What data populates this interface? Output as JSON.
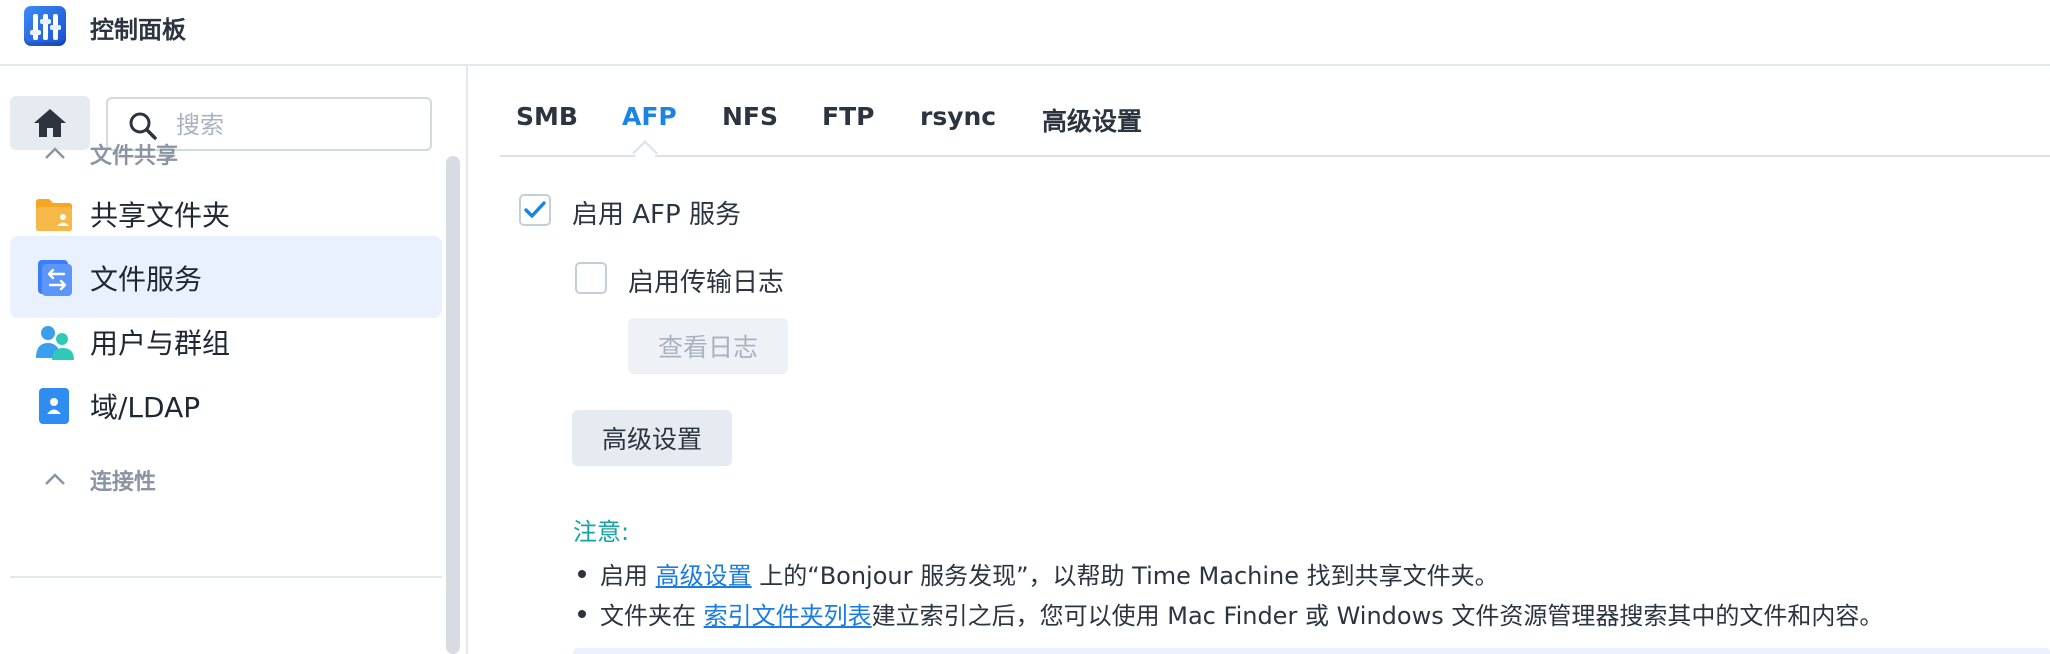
{
  "app": {
    "title": "控制面板",
    "icon": "control-panel-icon",
    "accent": "#1a84e5"
  },
  "sidebar": {
    "search_placeholder": "搜索",
    "sections": [
      {
        "label": "文件共享",
        "items": [
          {
            "label": "共享文件夹",
            "icon": "shared-folder-icon"
          },
          {
            "label": "文件服务",
            "icon": "file-services-icon",
            "active": true
          },
          {
            "label": "用户与群组",
            "icon": "user-group-icon"
          },
          {
            "label": "域/LDAP",
            "icon": "domain-ldap-icon"
          }
        ]
      },
      {
        "label": "连接性",
        "items": []
      }
    ]
  },
  "tabs": [
    {
      "label": "SMB"
    },
    {
      "label": "AFP",
      "active": true
    },
    {
      "label": "NFS"
    },
    {
      "label": "FTP"
    },
    {
      "label": "rsync"
    },
    {
      "label": "高级设置"
    }
  ],
  "afp": {
    "enable_label": "启用 AFP 服务",
    "enable_checked": true,
    "transfer_log_label": "启用传输日志",
    "transfer_log_checked": false,
    "view_log_button": "查看日志",
    "advanced_button": "高级设置"
  },
  "note": {
    "title": "注意:",
    "items": [
      {
        "before": "启用 ",
        "link": "高级设置",
        "after": " 上的“Bonjour 服务发现”，以帮助 Time Machine 找到共享文件夹。"
      },
      {
        "before": "文件夹在 ",
        "link": "索引文件夹列表",
        "after": "建立索引之后，您可以使用 Mac Finder 或 Windows 文件资源管理器搜索其中的文件和内容。"
      }
    ]
  }
}
